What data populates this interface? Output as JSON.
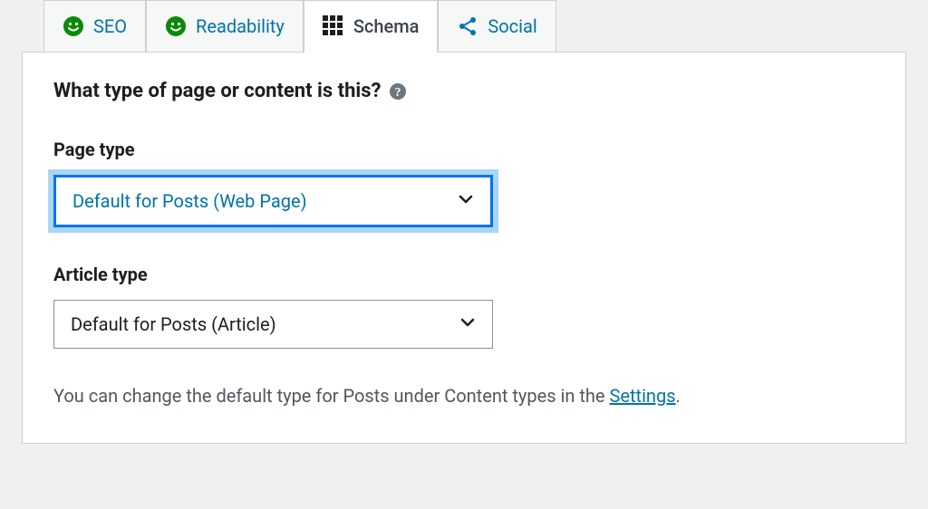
{
  "tabs": {
    "seo": "SEO",
    "readability": "Readability",
    "schema": "Schema",
    "social": "Social"
  },
  "panel": {
    "heading": "What type of page or content is this?",
    "pageTypeLabel": "Page type",
    "pageTypeValue": "Default for Posts (Web Page)",
    "articleTypeLabel": "Article type",
    "articleTypeValue": "Default for Posts (Article)",
    "footerPrefix": "You can change the default type for Posts under Content types in the ",
    "settingsLink": "Settings",
    "footerSuffix": "."
  }
}
